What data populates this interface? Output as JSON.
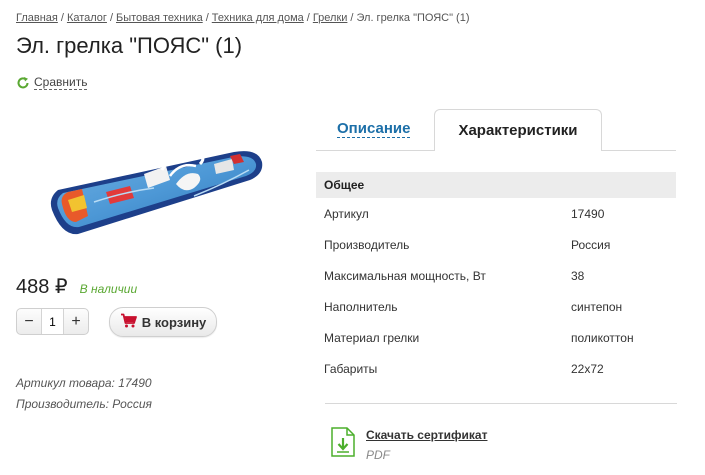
{
  "breadcrumb": [
    {
      "label": "Главная"
    },
    {
      "label": "Каталог"
    },
    {
      "label": "Бытовая техника"
    },
    {
      "label": "Техника для дома"
    },
    {
      "label": "Грелки"
    }
  ],
  "breadcrumb_current": "Эл. грелка \"ПОЯС\" (1)",
  "breadcrumb_separator": "/",
  "page_title": "Эл. грелка \"ПОЯС\" (1)",
  "compare": {
    "label": "Сравнить",
    "icon": "refresh-icon"
  },
  "product": {
    "price": "488 ₽",
    "stock": "В наличии",
    "quantity": "1",
    "qty_minus": "−",
    "qty_plus": "+",
    "cart_label": "В корзину",
    "cart_icon": "cart-icon",
    "article_line": "Артикул товара: 17490",
    "maker_line": "Производитель: Россия"
  },
  "tabs": [
    {
      "label": "Описание",
      "active": false
    },
    {
      "label": "Характеристики",
      "active": true
    }
  ],
  "specs": {
    "group": "Общее",
    "rows": [
      {
        "key": "Артикул",
        "value": "17490"
      },
      {
        "key": "Производитель",
        "value": "Россия"
      },
      {
        "key": "Максимальная мощность, Вт",
        "value": "38"
      },
      {
        "key": "Наполнитель",
        "value": "синтепон"
      },
      {
        "key": "Материал грелки",
        "value": "поликоттон"
      },
      {
        "key": "Габариты",
        "value": "22x72"
      }
    ]
  },
  "certificate": {
    "label": "Скачать сертификат",
    "type": "PDF",
    "icon": "download-file-icon"
  },
  "colors": {
    "link_blue": "#1c6fa8",
    "stock_green": "#5aa832",
    "cart_red": "#c8102e",
    "cert_green": "#4caf2c"
  }
}
